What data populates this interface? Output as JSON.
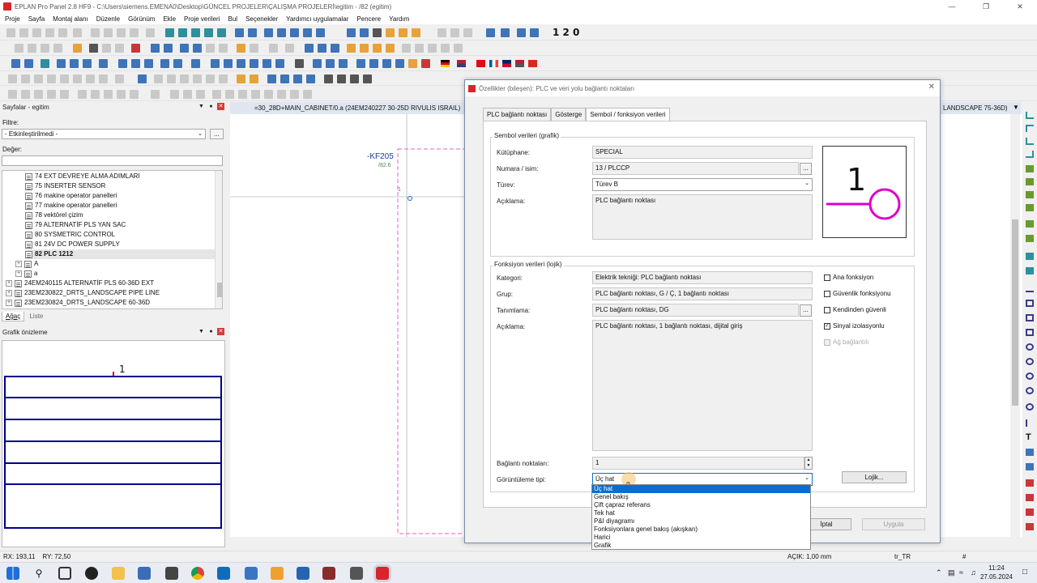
{
  "window": {
    "title": "EPLAN Pro Panel 2.8 HF9 - C:\\Users\\siemens.EMENA0\\Desktop\\GÜNCEL PROJELER\\ÇALIŞMA PROJELERİ\\egitim - /82 (egitim)"
  },
  "menu": [
    "Proje",
    "Sayfa",
    "Montaj alanı",
    "Düzenle",
    "Görünüm",
    "Ekle",
    "Proje verileri",
    "Bul",
    "Seçenekler",
    "Yardımcı uygulamalar",
    "Pencere",
    "Yardım"
  ],
  "toolbar": {
    "numbers": "1 2 0"
  },
  "pages_panel": {
    "title": "Sayfalar - egitim",
    "filter_label": "Filtre:",
    "filter_value": "- Etkinleştirilmedi -",
    "filter_btn": "...",
    "value_label": "Değer:",
    "tree": [
      "74 EXT DEVREYE ALMA ADIMLARI",
      "75 INSERTER SENSOR",
      "76 makine operator panelleri",
      "77 makine operator panelleri",
      "78 vektörel çizim",
      "79 ALTERNATİF PLS YAN SAC",
      "80 SYSMETRIC CONTROL",
      "81 24V DC POWER SUPPLY",
      "82 PLC 1212",
      "A",
      "a",
      "24EM240115 ALTERNATİF PLS 60-36D EXT",
      "23EM230822_DRTS_LANDSCAPE PIPE LINE",
      "23EM230824_DRTS_LANDSCAPE 60-36D"
    ],
    "tabs": [
      "Ağaç",
      "Liste"
    ]
  },
  "preview_panel": {
    "title": "Grafik önizleme",
    "label": "1"
  },
  "document": {
    "tab_left": "=30_28D+MAIN_CABINET/0.a (24EM240227 30-25D RIVULIS ISRAIL)",
    "tab_right": "LANDSCAPE 75-36D)",
    "device_tag": "-KF205",
    "device_ref": "/82.6",
    "pin_label": "1"
  },
  "dialog": {
    "title": "Özellikler (bileşen): PLC ve veri yolu bağlantı noktaları",
    "tabs": [
      "PLC bağlantı noktası",
      "Gösterge",
      "Sembol / fonksiyon verileri"
    ],
    "symbol_group": "Sembol verileri (grafik)",
    "library_label": "Kütüphane:",
    "library_value": "SPECIAL",
    "number_label": "Numara / isim:",
    "number_value": "13 / PLCCP",
    "variant_label": "Türev:",
    "variant_value": "Türev B",
    "desc_label": "Açıklama:",
    "desc_value": "PLC bağlantı noktası",
    "symbol_preview_text": "1",
    "function_group": "Fonksiyon verileri (lojik)",
    "category_label": "Kategori:",
    "category_value": "Elektrik tekniği: PLC bağlantı noktası",
    "group_label": "Grup:",
    "group_value": "PLC bağlantı noktası, G / Ç, 1 bağlantı noktası",
    "definition_label": "Tanımlama:",
    "definition_value": "PLC bağlantı noktası, DG",
    "fdesc_label": "Açıklama:",
    "fdesc_value": "PLC bağlantı noktası, 1 bağlantı noktası, dijital giriş",
    "checkboxes": [
      {
        "label": "Ana fonksiyon",
        "checked": false,
        "enabled": true
      },
      {
        "label": "Güvenlik fonksiyonu",
        "checked": false,
        "enabled": true
      },
      {
        "label": "Kendinden güvenli",
        "checked": false,
        "enabled": true
      },
      {
        "label": "Sinyal izolasyonlu",
        "checked": true,
        "enabled": true
      },
      {
        "label": "Ağ bağlantılı",
        "checked": false,
        "enabled": false
      }
    ],
    "connection_points_label": "Bağlantı noktaları:",
    "connection_points_value": "1",
    "display_type_label": "Görüntüleme tipi:",
    "display_type_value": "Üç hat",
    "logic_button": "Lojik...",
    "cancel_button": "İptal",
    "apply_button": "Uygula",
    "dropdown_options": [
      "Üç hat",
      "Genel bakış",
      "Çift çapraz referans",
      "Tek hat",
      "P&I diyagramı",
      "Fonksiyonlara genel bakış (akışkan)",
      "Harici",
      "Grafik"
    ],
    "dropdown_selected": 0
  },
  "status": {
    "coords": "RX: 193,11    RY: 72,50",
    "grid": "AÇIK: 1,00 mm",
    "lang": "tr_TR",
    "hash": "#"
  },
  "taskbar": {
    "time": "11:24",
    "date": "27.05.2024"
  },
  "colors": {
    "accent": "#0a6ed1",
    "symbol_magenta": "#e000c8",
    "preview_blue": "#00008b",
    "eplan_red": "#d7262b"
  }
}
